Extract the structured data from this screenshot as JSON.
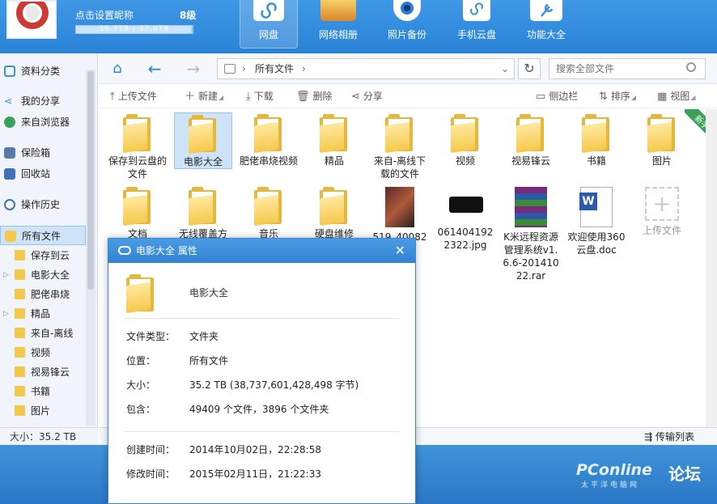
{
  "header": {
    "nickname": "点击设置昵称",
    "level": "8级",
    "quota_text": "36.7TB / 37.0TB",
    "quota_fraction": 0.99,
    "nav": [
      {
        "label": "网盘",
        "icon": "cloud-icon"
      },
      {
        "label": "网络相册",
        "icon": "photo-album-icon"
      },
      {
        "label": "照片备份",
        "icon": "camera-icon"
      },
      {
        "label": "手机云盘",
        "icon": "phone-icon"
      },
      {
        "label": "功能大全",
        "icon": "tools-icon"
      }
    ]
  },
  "sidebar": {
    "top_items": [
      {
        "label": "资料分类",
        "icon": "category-icon"
      },
      {
        "label": "我的分享",
        "icon": "share-icon"
      },
      {
        "label": "来自浏览器",
        "icon": "browser-icon"
      },
      {
        "label": "保险箱",
        "icon": "safe-icon"
      },
      {
        "label": "回收站",
        "icon": "recycle-bin-icon"
      },
      {
        "label": "操作历史",
        "icon": "history-icon"
      },
      {
        "label": "所有文件",
        "icon": "folder-icon"
      }
    ],
    "tree": [
      {
        "label": "保存到云",
        "expandable": false
      },
      {
        "label": "电影大全",
        "expandable": true
      },
      {
        "label": "肥佬串烧",
        "expandable": false
      },
      {
        "label": "精品",
        "expandable": true
      },
      {
        "label": "来自-离线",
        "expandable": false
      },
      {
        "label": "视频",
        "expandable": false
      },
      {
        "label": "视易锋云",
        "expandable": false
      },
      {
        "label": "书籍",
        "expandable": false
      },
      {
        "label": "图片",
        "expandable": false
      }
    ],
    "status": "大小：35.2 TB"
  },
  "address": {
    "path": "所有文件",
    "search_placeholder": "搜索全部文件"
  },
  "toolbar": {
    "upload": "上传文件",
    "new": "新建",
    "download": "下载",
    "delete": "删除",
    "share": "分享",
    "sidebar": "侧边栏",
    "sort": "排序",
    "view": "视图"
  },
  "files": [
    {
      "name": "保存到云盘的文件",
      "type": "folder"
    },
    {
      "name": "电影大全",
      "type": "folder",
      "selected": true
    },
    {
      "name": "肥佬串烧视频",
      "type": "folder"
    },
    {
      "name": "精品",
      "type": "folder"
    },
    {
      "name": "来自-离线下载的文件",
      "type": "folder"
    },
    {
      "name": "视频",
      "type": "folder"
    },
    {
      "name": "视易锋云",
      "type": "folder"
    },
    {
      "name": "书籍",
      "type": "folder"
    },
    {
      "name": "图片",
      "type": "folder"
    },
    {
      "name": "文档",
      "type": "folder"
    },
    {
      "name": "无线覆盖方",
      "type": "folder"
    },
    {
      "name": "音乐",
      "type": "folder"
    },
    {
      "name": "硬盘维修",
      "type": "folder"
    },
    {
      "name": "519_40082G",
      "type": "image"
    },
    {
      "name": "0614041922322.jpg",
      "type": "image"
    },
    {
      "name": "K米远程资源管理系统v1.6.6-20141022.rar",
      "type": "rar"
    },
    {
      "name": "欢迎使用360云盘.doc",
      "type": "doc"
    },
    {
      "name": "上传文件",
      "type": "upload"
    }
  ],
  "new_badge": "新手",
  "status": {
    "transfer": "传输列表"
  },
  "dialog": {
    "title": "电影大全 属性",
    "name": "电影大全",
    "rows": [
      {
        "label": "文件类型：",
        "value": "文件夹"
      },
      {
        "label": "位置：",
        "value": "所有文件"
      },
      {
        "label": "大小：",
        "value": "35.2 TB (38,737,601,428,498 字节)"
      },
      {
        "label": "包含：",
        "value": "49409 个文件，3896 个文件夹"
      },
      {
        "label": "创建时间：",
        "value": "2014年10月02日，22:28:58"
      },
      {
        "label": "修改时间：",
        "value": "2015年02月11日，21:22:33"
      }
    ]
  },
  "watermark": {
    "brand": "PConline",
    "sub": "太平洋电脑网",
    "forum": "论坛"
  }
}
